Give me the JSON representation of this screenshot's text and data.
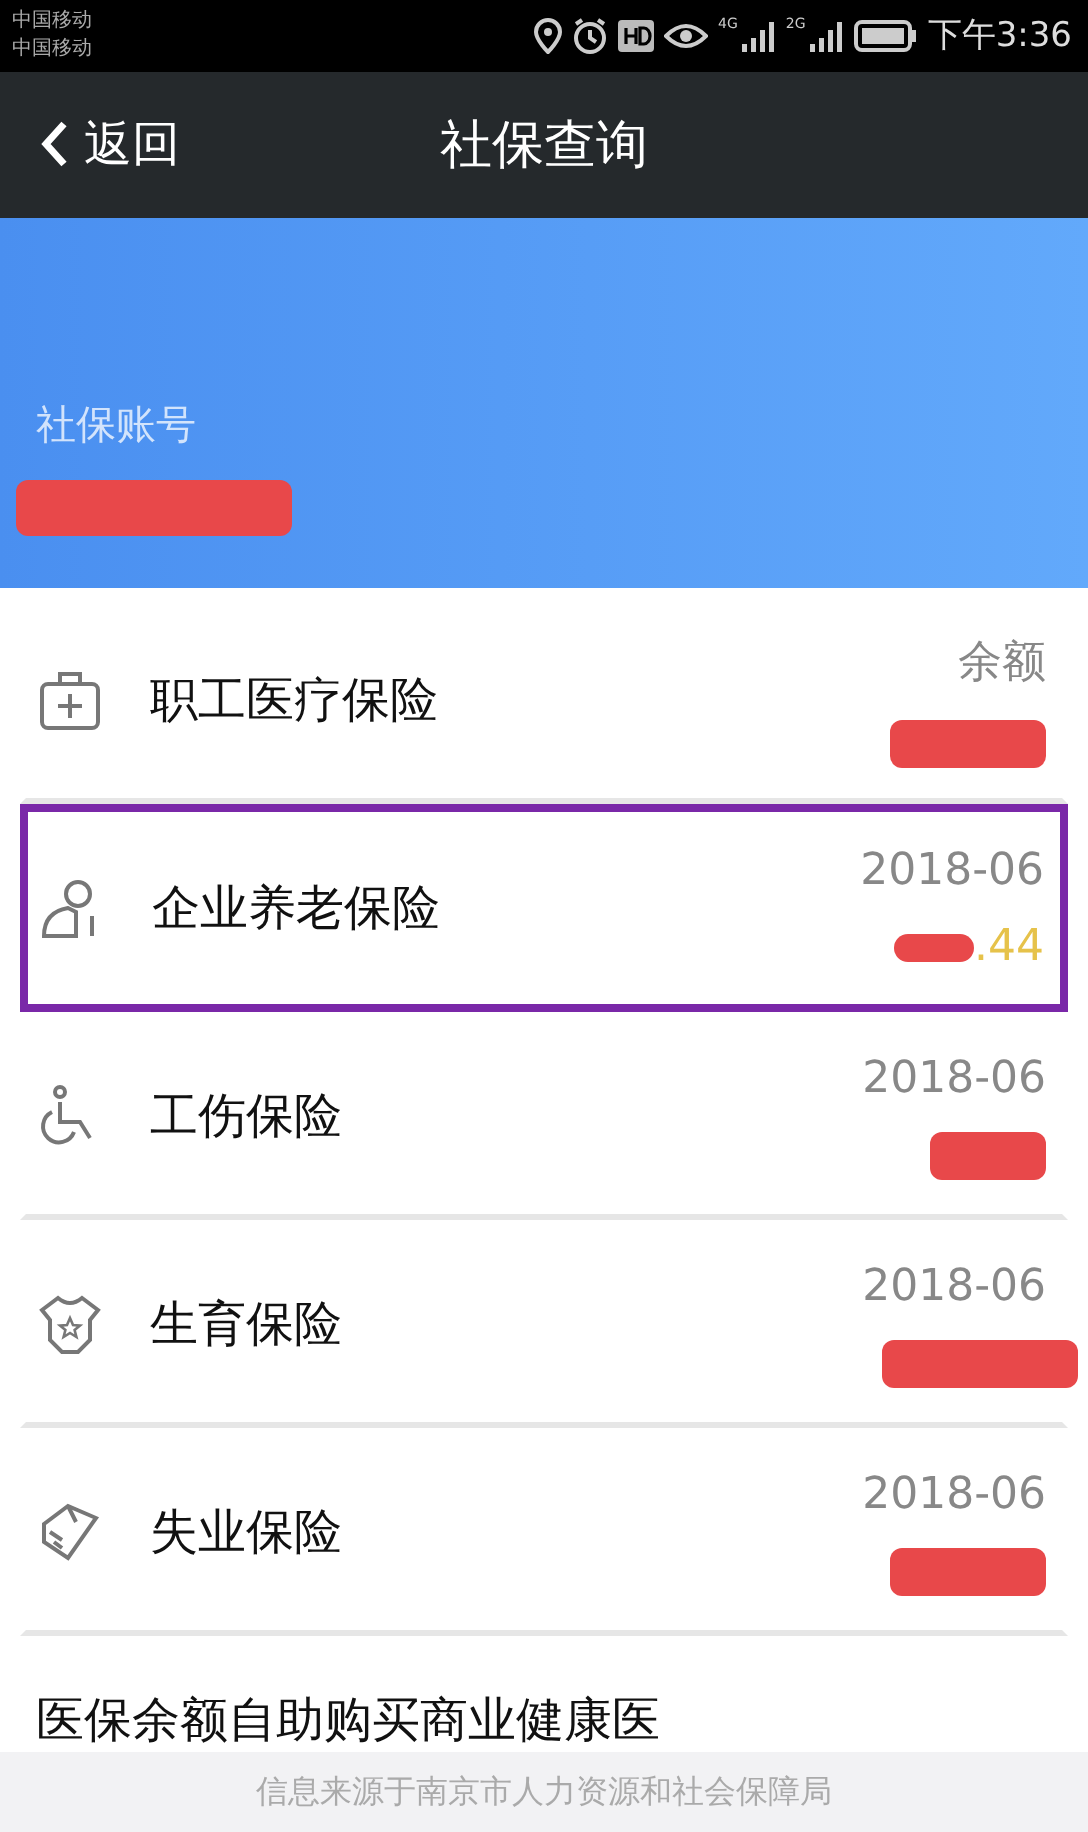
{
  "status_bar": {
    "carriers": [
      "中国移动",
      "中国移动"
    ],
    "network_1": "4G",
    "network_2": "2G",
    "time": "下午3:36"
  },
  "header": {
    "back": "返回",
    "title": "社保查询"
  },
  "account": {
    "label": "社保账号",
    "redacted": true
  },
  "items": [
    {
      "kind": "medical",
      "label": "职工医疗保险",
      "heading": "余额",
      "redacted": true,
      "highlighted": false
    },
    {
      "kind": "pension",
      "label": "企业养老保险",
      "heading": "2018-06",
      "amount_tail": ".44",
      "redacted": true,
      "highlighted": true
    },
    {
      "kind": "injury",
      "label": "工伤保险",
      "heading": "2018-06",
      "redacted": true,
      "highlighted": false
    },
    {
      "kind": "maternity",
      "label": "生育保险",
      "heading": "2018-06",
      "redacted": true,
      "highlighted": false
    },
    {
      "kind": "unemployment",
      "label": "失业保险",
      "heading": "2018-06",
      "redacted": true,
      "highlighted": false
    }
  ],
  "promo": "医保余额自助购买商业健康医",
  "footer": "信息来源于南京市人力资源和社会保障局"
}
